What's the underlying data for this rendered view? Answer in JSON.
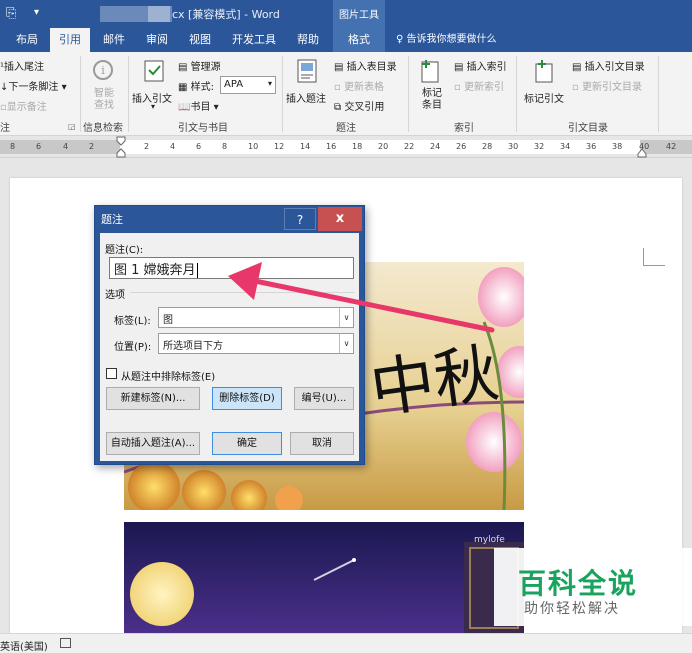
{
  "titlebar": {
    "title": "cx [兼容模式] - Word",
    "context_tools": "图片工具"
  },
  "tabs": [
    {
      "label": "布局"
    },
    {
      "label": "引用"
    },
    {
      "label": "邮件"
    },
    {
      "label": "审阅"
    },
    {
      "label": "视图"
    },
    {
      "label": "开发工具"
    },
    {
      "label": "帮助"
    },
    {
      "label": "格式"
    }
  ],
  "tell_me": "告诉我你想要做什么",
  "ribbon": {
    "footnotes": {
      "insert_endnote": "插入尾注",
      "next_footnote": "下一条脚注",
      "show_notes": "显示备注",
      "group": "注"
    },
    "research": {
      "smart_lookup": "智能查找",
      "group": "信息检索"
    },
    "citations": {
      "insert_citation": "插入引文",
      "manage_sources": "管理源",
      "style_label": "样式:",
      "style_value": "APA",
      "bibliography": "书目",
      "group": "引文与书目"
    },
    "captions": {
      "insert_caption": "插入题注",
      "insert_table_of_figures": "插入表目录",
      "update_table": "更新表格",
      "cross_reference": "交叉引用",
      "group": "题注"
    },
    "index": {
      "mark_entry": "标记条目",
      "insert_index": "插入索引",
      "update_index": "更新索引",
      "group": "索引"
    },
    "toa": {
      "mark_citation": "标记引文",
      "insert_toa": "插入引文目录",
      "update_toa": "更新引文目录",
      "group": "引文目录"
    }
  },
  "ruler": {
    "ticks": [
      "8",
      "6",
      "4",
      "2",
      "2",
      "4",
      "6",
      "8",
      "10",
      "12",
      "14",
      "16",
      "18",
      "20",
      "22",
      "24",
      "26",
      "28",
      "30",
      "32",
      "34",
      "36",
      "38",
      "40",
      "42"
    ]
  },
  "dialog": {
    "title": "题注",
    "help": "?",
    "close": "x",
    "caption_label": "题注(C):",
    "caption_value": "图 1 嫦娥奔月",
    "options_label": "选项",
    "label_label": "标签(L):",
    "label_value": "图",
    "position_label": "位置(P):",
    "position_value": "所选项目下方",
    "exclude_label": "从题注中排除标签(E)",
    "new_label_btn": "新建标签(N)...",
    "delete_label_btn": "删除标签(D)",
    "numbering_btn": "编号(U)...",
    "autocaption_btn": "自动插入题注(A)...",
    "ok_btn": "确定",
    "cancel_btn": "取消"
  },
  "image1": {
    "calligraphy": "中秋"
  },
  "image2": {
    "brand": "mylofe"
  },
  "statusbar": {
    "language": "英语(美国)"
  },
  "watermark": {
    "brand": "百科全说",
    "slogan": "助你轻松解决"
  },
  "colors": {
    "accent": "#2b579a",
    "arrow": "#e8386a",
    "watermark_green": "#1aa35e"
  }
}
